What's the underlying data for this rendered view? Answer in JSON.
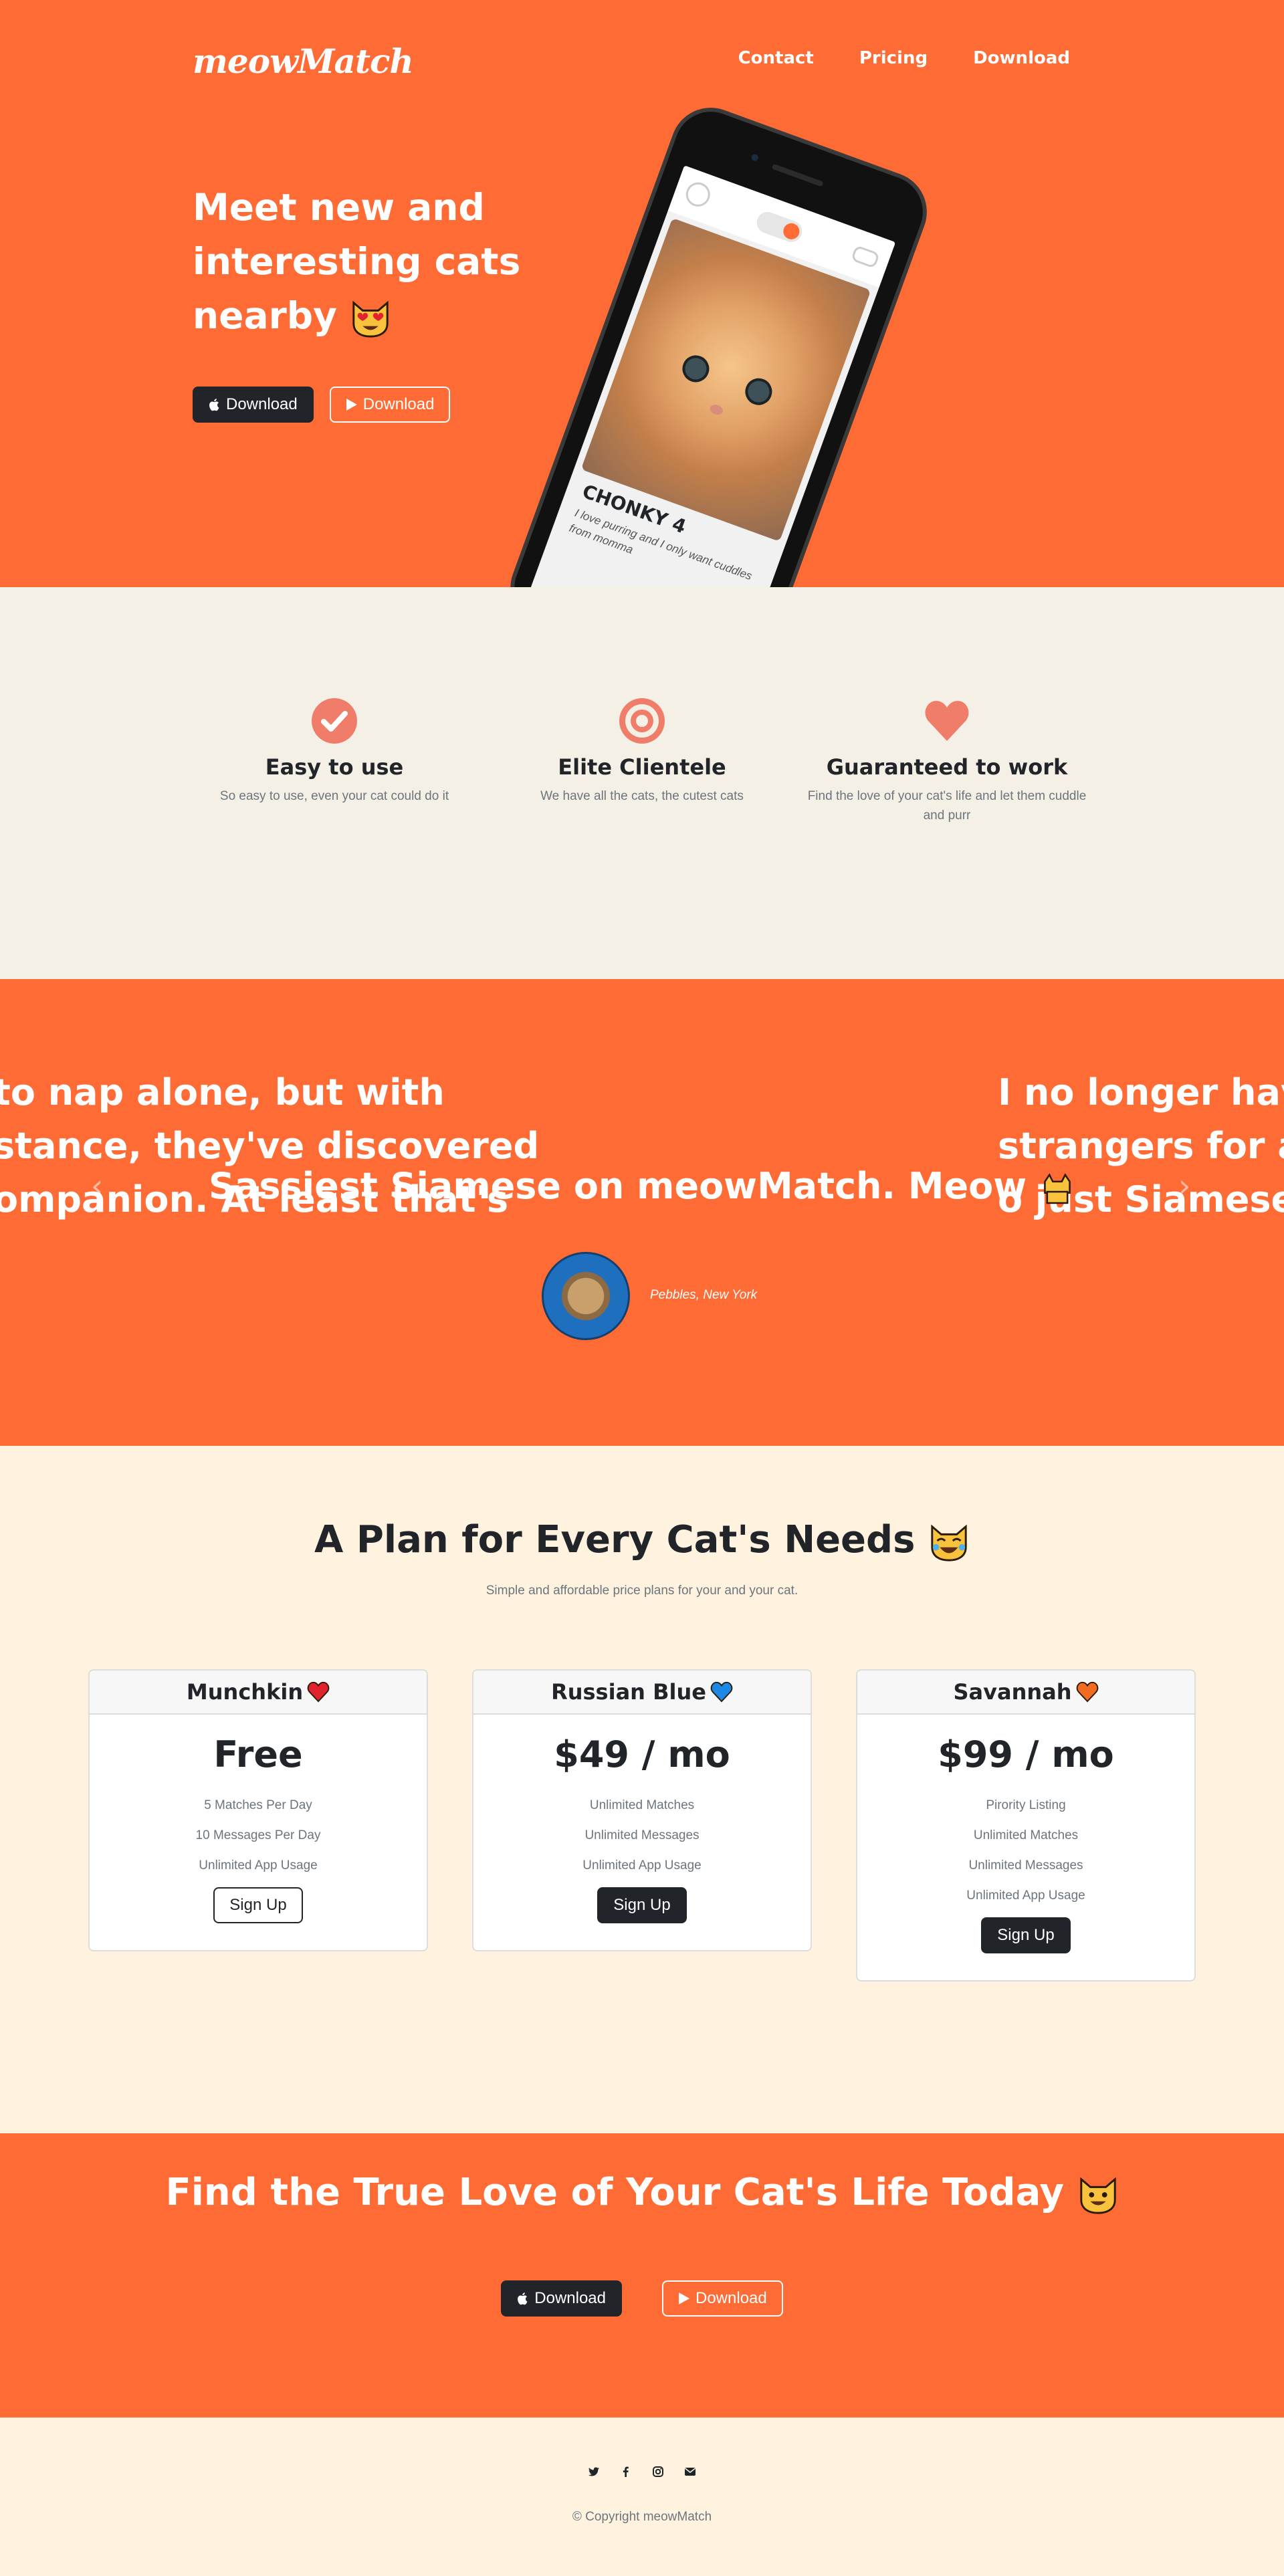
{
  "brand": "meowMatch",
  "nav": {
    "contact": "Contact",
    "pricing": "Pricing",
    "download": "Download"
  },
  "hero": {
    "title": "Meet new and interesting cats nearby",
    "download_apple": "Download",
    "download_google": "Download"
  },
  "phone_card": {
    "name": "CHONKY 4",
    "desc": "I love purring and I only want cuddles from momma"
  },
  "features": [
    {
      "title": "Easy to use",
      "text": "So easy to use, even your cat could do it",
      "icon": "check-circle-icon"
    },
    {
      "title": "Elite Clientele",
      "text": "We have all the cats, the cutest cats",
      "icon": "bullseye-icon"
    },
    {
      "title": "Guaranteed to work",
      "text": "Find the love of your cat's life and let them cuddle and purr",
      "icon": "heart-icon"
    }
  ],
  "testimonials": {
    "left_line1": "to nap alone, but with",
    "left_line2": "stance, they've discovered",
    "left_line3": "ompanion. At least that's",
    "center_line": "Sassiest Siamese on meowMatch. Meow",
    "right_line1": "I no longer hav",
    "right_line2": "strangers for a",
    "right_line3": "o just Siamese",
    "author": "Pebbles, New York"
  },
  "pricing": {
    "title": "A Plan for Every Cat's Needs",
    "subtitle": "Simple and affordable price plans for your and your cat.",
    "plans": [
      {
        "name": "Munchkin",
        "heart_color": "#e0232e",
        "price": "Free",
        "features": [
          "5 Matches Per Day",
          "10 Messages Per Day",
          "Unlimited App Usage"
        ],
        "button": "Sign Up"
      },
      {
        "name": "Russian Blue",
        "heart_color": "#1e88e5",
        "price": "$49 / mo",
        "features": [
          "Unlimited Matches",
          "Unlimited Messages",
          "Unlimited App Usage"
        ],
        "button": "Sign Up"
      },
      {
        "name": "Savannah",
        "heart_color": "#f26b21",
        "price": "$99 / mo",
        "features": [
          "Pirority Listing",
          "Unlimited Matches",
          "Unlimited Messages",
          "Unlimited App Usage"
        ],
        "button": "Sign Up"
      }
    ]
  },
  "cta": {
    "title": "Find the True Love of Your Cat's Life Today",
    "download_apple": "Download",
    "download_google": "Download"
  },
  "footer": {
    "copyright": "© Copyright meowMatch"
  },
  "colors": {
    "accent": "#ff6b35",
    "dark": "#212529",
    "cream": "#fff3df",
    "beige": "#f5f0e6"
  }
}
